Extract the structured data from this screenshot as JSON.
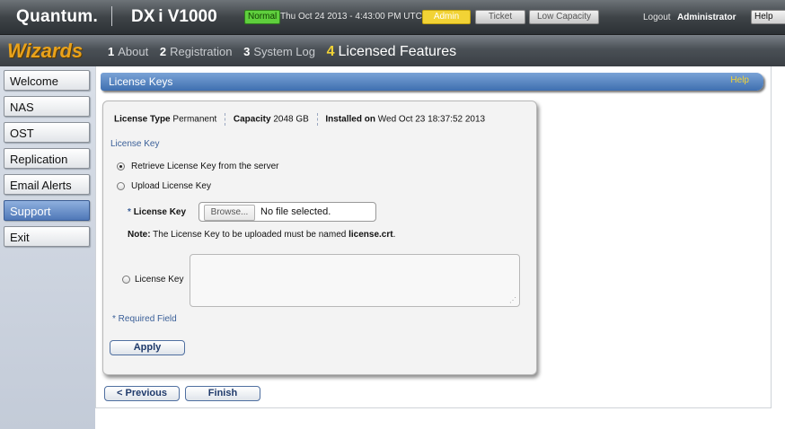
{
  "header": {
    "logo": "Quantum.",
    "model": "DX i V1000",
    "status": "Normal",
    "datetime": "Thu Oct 24 2013 - 4:43:00 PM UTC",
    "admin_label": "Admin",
    "ticket_label": "Ticket",
    "low_capacity_label": "Low Capacity",
    "logout_label": "Logout",
    "user": "Administrator",
    "help_label": "Help"
  },
  "wizard": {
    "title": "Wizards",
    "steps": [
      {
        "num": "1",
        "label": "About"
      },
      {
        "num": "2",
        "label": "Registration"
      },
      {
        "num": "3",
        "label": "System Log"
      },
      {
        "num": "4",
        "label": "Licensed Features"
      }
    ],
    "current_step": 4
  },
  "sidebar": {
    "items": [
      {
        "label": "Welcome"
      },
      {
        "label": "NAS"
      },
      {
        "label": "OST"
      },
      {
        "label": "Replication"
      },
      {
        "label": "Email Alerts"
      },
      {
        "label": "Support"
      },
      {
        "label": "Exit"
      }
    ],
    "active": "Support"
  },
  "panel": {
    "title": "License Keys",
    "help": "Help"
  },
  "license": {
    "type_label": "License Type",
    "type_value": "Permanent",
    "capacity_label": "Capacity",
    "capacity_value": "2048 GB",
    "installed_label": "Installed on",
    "installed_value": "Wed Oct 23 18:37:52 2013",
    "section_label": "License Key",
    "option_retrieve": "Retrieve License Key from the server",
    "option_upload": "Upload License Key",
    "upload_star": "*",
    "upload_label": "License Key",
    "browse_label": "Browse...",
    "file_status": "No file selected.",
    "note_label": "Note:",
    "note_text": "The License Key to be uploaded must be named",
    "note_file": "license.crt",
    "note_end": ".",
    "option_paste": "License Key",
    "textarea_value": "",
    "required_field": "* Required Field",
    "selected_option": "retrieve"
  },
  "buttons": {
    "apply": "Apply",
    "previous": "< Previous",
    "finish": "Finish"
  },
  "colors": {
    "accent": "#3e6fb0",
    "wizard_title": "#e9a21b",
    "normal_badge": "#5fcf3d",
    "admin_badge": "#f2d335"
  }
}
